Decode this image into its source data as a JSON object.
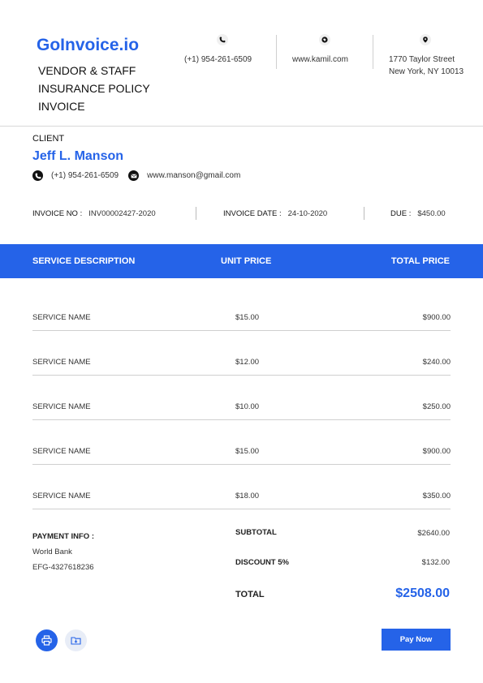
{
  "brand": {
    "name": "GoInvoice.io"
  },
  "document": {
    "title_lines": [
      "VENDOR & STAFF",
      "INSURANCE POLICY",
      "INVOICE"
    ]
  },
  "company_contact": {
    "phone": "(+1) 954-261-6509",
    "website": "www.kamil.com",
    "address_line1": "1770 Taylor Street",
    "address_line2": "New York, NY 10013",
    "icons": [
      "phone-icon",
      "globe-icon",
      "location-pin-icon"
    ]
  },
  "client": {
    "label": "CLIENT",
    "name": "Jeff L. Manson",
    "phone": "(+1) 954-261-6509",
    "email": "www.manson@gmail.com"
  },
  "meta": {
    "invoice_no_label": "INVOICE NO :",
    "invoice_no": "INV00002427-2020",
    "invoice_date_label": "INVOICE DATE :",
    "invoice_date": "24-10-2020",
    "due_label": "DUE :",
    "due": "$450.00"
  },
  "table": {
    "headers": [
      "SERVICE DESCRIPTION",
      "UNIT PRICE",
      "TOTAL PRICE"
    ],
    "rows": [
      {
        "name": "SERVICE NAME",
        "unit": "$15.00",
        "total": "$900.00"
      },
      {
        "name": "SERVICE NAME",
        "unit": "$12.00",
        "total": "$240.00"
      },
      {
        "name": "SERVICE NAME",
        "unit": "$10.00",
        "total": "$250.00"
      },
      {
        "name": "SERVICE NAME",
        "unit": "$15.00",
        "total": "$900.00"
      },
      {
        "name": "SERVICE NAME",
        "unit": "$18.00",
        "total": "$350.00"
      }
    ]
  },
  "payment": {
    "label": "PAYMENT INFO :",
    "bank": "World Bank",
    "account": "EFG-4327618236"
  },
  "summary": {
    "subtotal_label": "SUBTOTAL",
    "subtotal": "$2640.00",
    "discount_label": "DISCOUNT 5%",
    "discount": "$132.00",
    "total_label": "TOTAL",
    "total": "$2508.00"
  },
  "actions": {
    "pay_label": "Pay Now"
  },
  "colors": {
    "accent": "#2563e8",
    "divider": "#cfcfcf"
  }
}
